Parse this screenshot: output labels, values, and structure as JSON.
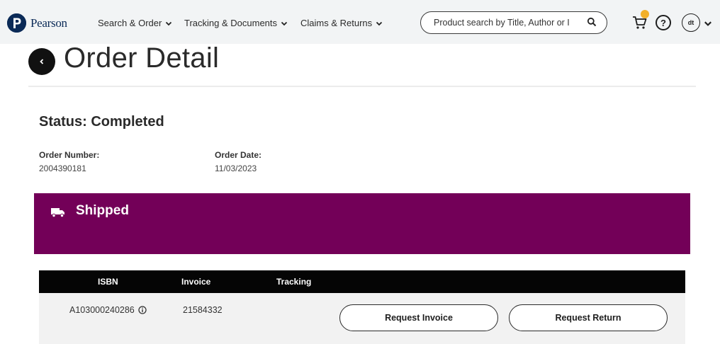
{
  "header": {
    "brand": "Pearson",
    "nav": [
      {
        "label": "Search & Order"
      },
      {
        "label": "Tracking & Documents"
      },
      {
        "label": "Claims & Returns"
      }
    ],
    "search_placeholder": "Product search by Title, Author or I",
    "avatar_initials": "dt",
    "help_glyph": "?"
  },
  "page": {
    "title": "Order Detail",
    "status": "Status: Completed",
    "order_number_label": "Order Number:",
    "order_number": "2004390181",
    "order_date_label": "Order Date:",
    "order_date": "11/03/2023"
  },
  "banner": {
    "label": "Shipped",
    "color": "#730058"
  },
  "table": {
    "columns": [
      "ISBN",
      "Invoice",
      "Tracking"
    ],
    "rows": [
      {
        "isbn": "A103000240286",
        "invoice": "21584332",
        "tracking": ""
      }
    ],
    "request_invoice_label": "Request Invoice",
    "request_return_label": "Request Return"
  },
  "colors": {
    "brand_navy": "#0b2a57",
    "cart_badge": "#f2b02a",
    "table_header": "#050505"
  }
}
